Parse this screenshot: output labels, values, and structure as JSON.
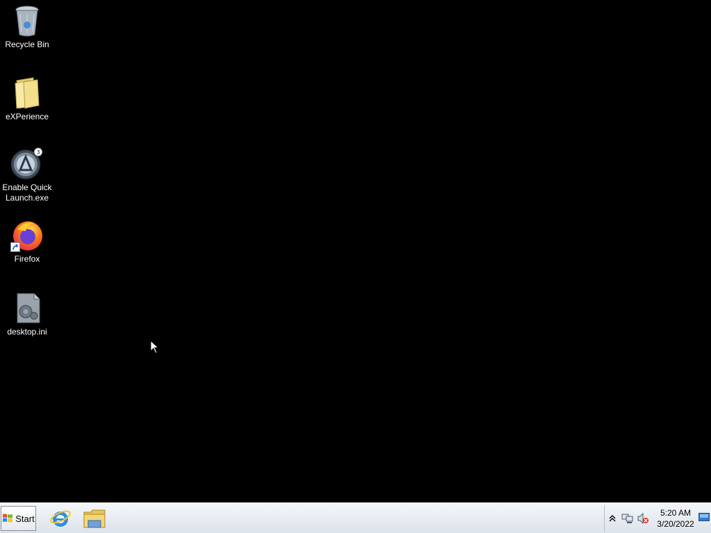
{
  "desktop": {
    "background_color": "#000000",
    "icons": [
      {
        "label": "Recycle Bin",
        "icon": "recycle-bin-icon"
      },
      {
        "label": "eXPerience",
        "icon": "folder-icon"
      },
      {
        "label": "Enable Quick\nLaunch.exe",
        "icon": "app-launcher-icon"
      },
      {
        "label": "Firefox",
        "icon": "firefox-icon"
      },
      {
        "label": "desktop.ini",
        "icon": "settings-file-icon"
      }
    ]
  },
  "taskbar": {
    "start_label": "Start",
    "pinned": [
      {
        "name": "Internet Explorer",
        "icon": "internet-explorer-icon"
      },
      {
        "name": "Windows Explorer",
        "icon": "file-explorer-icon"
      }
    ],
    "tray": {
      "icons": [
        "show-hidden-icons-chevron",
        "network-icon",
        "volume-muted-icon"
      ],
      "time": "5:20 AM",
      "date": "3/20/2022"
    }
  }
}
